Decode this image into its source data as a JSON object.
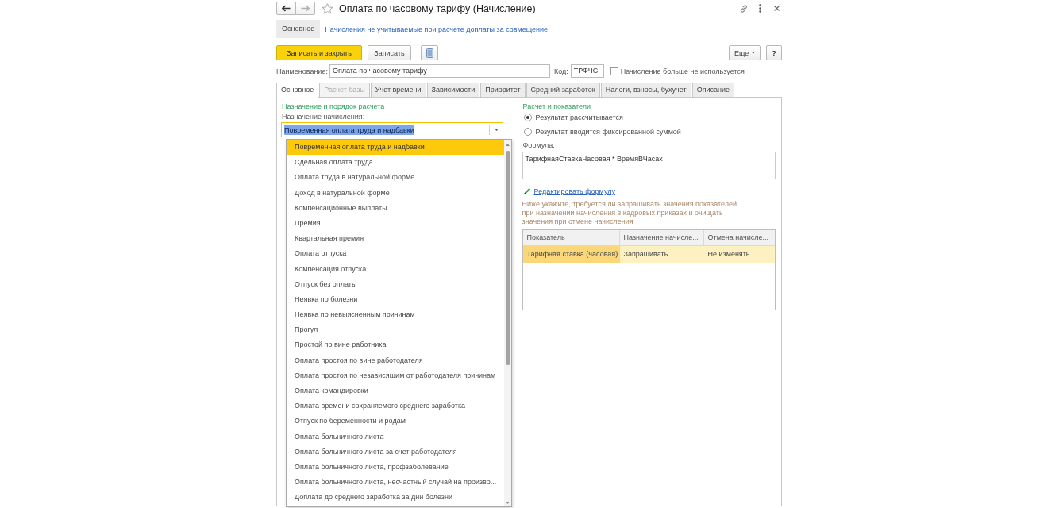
{
  "window": {
    "title": "Оплата по часовому тарифу (Начисление)",
    "favorite": false
  },
  "nav_buttons": [
    {
      "kind": "back",
      "disabled": false
    },
    {
      "kind": "forward",
      "disabled": true
    }
  ],
  "sections": [
    {
      "label": "Основное",
      "selected": true
    },
    {
      "label": "Начисления не учитываемые при расчете доплаты за совмещение",
      "selected": false
    }
  ],
  "toolbar": {
    "buttons": [
      {
        "kind": "primary",
        "label": "Записать и закрыть"
      },
      {
        "kind": "default",
        "label": "Записать"
      },
      {
        "kind": "icon"
      }
    ],
    "more": "Еще",
    "help": "?"
  },
  "header_fields": {
    "name_label": "Наименование:",
    "name_value": "Оплата по часовому тарифу",
    "code_label": "Код:",
    "code_value": "ТРФЧС",
    "unused": {
      "label": "Начисление больше не используется",
      "checked": false
    }
  },
  "tabs": [
    {
      "label": "Основное",
      "selected": true,
      "disabled": false
    },
    {
      "label": "Расчет базы",
      "selected": false,
      "disabled": true
    },
    {
      "label": "Учет времени",
      "selected": false,
      "disabled": false
    },
    {
      "label": "Зависимости",
      "selected": false,
      "disabled": false
    },
    {
      "label": "Приоритет",
      "selected": false,
      "disabled": false
    },
    {
      "label": "Средний заработок",
      "selected": false,
      "disabled": false
    },
    {
      "label": "Налоги, взносы, бухучет",
      "selected": false,
      "disabled": false
    },
    {
      "label": "Описание",
      "selected": false,
      "disabled": false
    }
  ],
  "purpose": {
    "heading": "Назначение и порядок расчета",
    "label": "Назначение начисления:",
    "value": "Повременная оплата труда и надбавки",
    "focused": true,
    "value_selected": true,
    "options": [
      {
        "label": "Повременная оплата труда и надбавки",
        "selected": true
      },
      {
        "label": "Сдельная оплата труда",
        "selected": false
      },
      {
        "label": "Оплата труда в натуральной форме",
        "selected": false
      },
      {
        "label": "Доход в натуральной форме",
        "selected": false
      },
      {
        "label": "Компенсационные выплаты",
        "selected": false
      },
      {
        "label": "Премия",
        "selected": false
      },
      {
        "label": "Квартальная премия",
        "selected": false
      },
      {
        "label": "Оплата отпуска",
        "selected": false
      },
      {
        "label": "Компенсация отпуска",
        "selected": false
      },
      {
        "label": "Отпуск без оплаты",
        "selected": false
      },
      {
        "label": "Неявка по болезни",
        "selected": false
      },
      {
        "label": "Неявка по невыясненным причинам",
        "selected": false
      },
      {
        "label": "Прогул",
        "selected": false
      },
      {
        "label": "Простой по вине работника",
        "selected": false
      },
      {
        "label": "Оплата простоя по вине работодателя",
        "selected": false
      },
      {
        "label": "Оплата простоя по независящим от работодателя причинам",
        "selected": false
      },
      {
        "label": "Оплата командировки",
        "selected": false
      },
      {
        "label": "Оплата времени сохраняемого среднего заработка",
        "selected": false
      },
      {
        "label": "Отпуск по беременности и родам",
        "selected": false
      },
      {
        "label": "Оплата больничного листа",
        "selected": false
      },
      {
        "label": "Оплата больничного листа за счет работодателя",
        "selected": false
      },
      {
        "label": "Оплата больничного листа, профзаболевание",
        "selected": false
      },
      {
        "label": "Оплата больничного листа, несчастный случай на произво...",
        "selected": false
      },
      {
        "label": "Доплата до среднего заработка за дни болезни",
        "selected": false
      }
    ]
  },
  "calculation": {
    "heading": "Расчет и показатели",
    "modes": [
      {
        "label": "Результат рассчитывается",
        "selected": true
      },
      {
        "label": "Результат вводится фиксированной суммой",
        "selected": false
      }
    ],
    "formula_label": "Формула:",
    "formula": "ТарифнаяСтавкаЧасовая * ВремяВЧасах",
    "edit_link": "Редактировать формулу",
    "hint": "Ниже укажите, требуется ли запрашивать значения показателей при назначении начисления в кадровых приказах и очищать значения при отмене начисления",
    "table": {
      "columns": [
        "Показатель",
        "Назначение начисле...",
        "Отмена начисле..."
      ],
      "rows": [
        {
          "selected": true,
          "cells": [
            {
              "text": "Тарифная ставка (часовая)",
              "current": true
            },
            {
              "text": "Запрашивать",
              "current": false
            },
            {
              "text": "Не изменять",
              "current": false
            }
          ]
        }
      ]
    }
  }
}
